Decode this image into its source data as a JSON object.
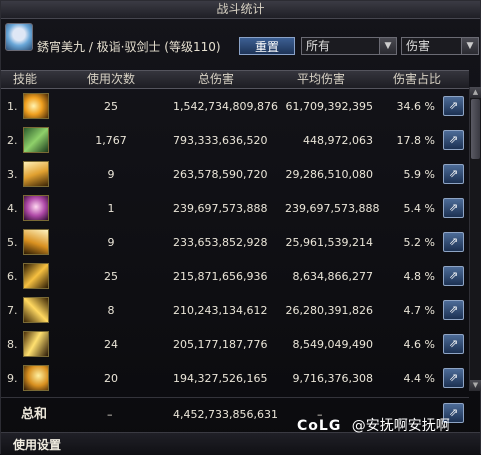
{
  "window": {
    "title": "战斗统计"
  },
  "character": {
    "name": "銹宵美九 / 极诣·驭剑士 (等级110)"
  },
  "toolbar": {
    "reset_label": "重置",
    "filter_selected": "所有",
    "metric_selected": "伤害"
  },
  "columns": {
    "skill": "技能",
    "uses": "使用次数",
    "total": "总伤害",
    "avg": "平均伤害",
    "share": "伤害占比"
  },
  "rows": [
    {
      "rank": "1.",
      "uses": "25",
      "total": "1,542,734,809,876",
      "avg": "61,709,392,395",
      "share": "34.6 %",
      "icon": "sword-burst-icon"
    },
    {
      "rank": "2.",
      "uses": "1,767",
      "total": "793,333,636,520",
      "avg": "448,972,063",
      "share": "17.8 %",
      "icon": "green-blades-icon"
    },
    {
      "rank": "3.",
      "uses": "9",
      "total": "263,578,590,720",
      "avg": "29,286,510,080",
      "share": "5.9 %",
      "icon": "sword-rain-icon"
    },
    {
      "rank": "4.",
      "uses": "1",
      "total": "239,697,573,888",
      "avg": "239,697,573,888",
      "share": "5.4 %",
      "icon": "summon-figure-icon"
    },
    {
      "rank": "5.",
      "uses": "9",
      "total": "233,653,852,928",
      "avg": "25,961,539,214",
      "share": "5.2 %",
      "icon": "sword-slash-icon"
    },
    {
      "rank": "6.",
      "uses": "25",
      "total": "215,871,656,936",
      "avg": "8,634,866,277",
      "share": "4.8 %",
      "icon": "diagonal-slash-icon"
    },
    {
      "rank": "7.",
      "uses": "8",
      "total": "210,243,134,612",
      "avg": "26,280,391,826",
      "share": "4.7 %",
      "icon": "sword-strike-icon"
    },
    {
      "rank": "8.",
      "uses": "24",
      "total": "205,177,187,776",
      "avg": "8,549,049,490",
      "share": "4.6 %",
      "icon": "wave-slash-icon"
    },
    {
      "rank": "9.",
      "uses": "20",
      "total": "194,327,526,165",
      "avg": "9,716,376,308",
      "share": "4.4 %",
      "icon": "spiral-slash-icon"
    }
  ],
  "total_row": {
    "label": "总和",
    "uses": "–",
    "total": "4,452,733,856,631",
    "avg": "–"
  },
  "footer": {
    "settings_label": "使用设置"
  },
  "watermark": {
    "logo": "CoLG",
    "text": "@安抚啊安抚啊"
  },
  "colors": {
    "accent_gold": "#f0c03a",
    "button_blue": "#2c4a7a"
  }
}
